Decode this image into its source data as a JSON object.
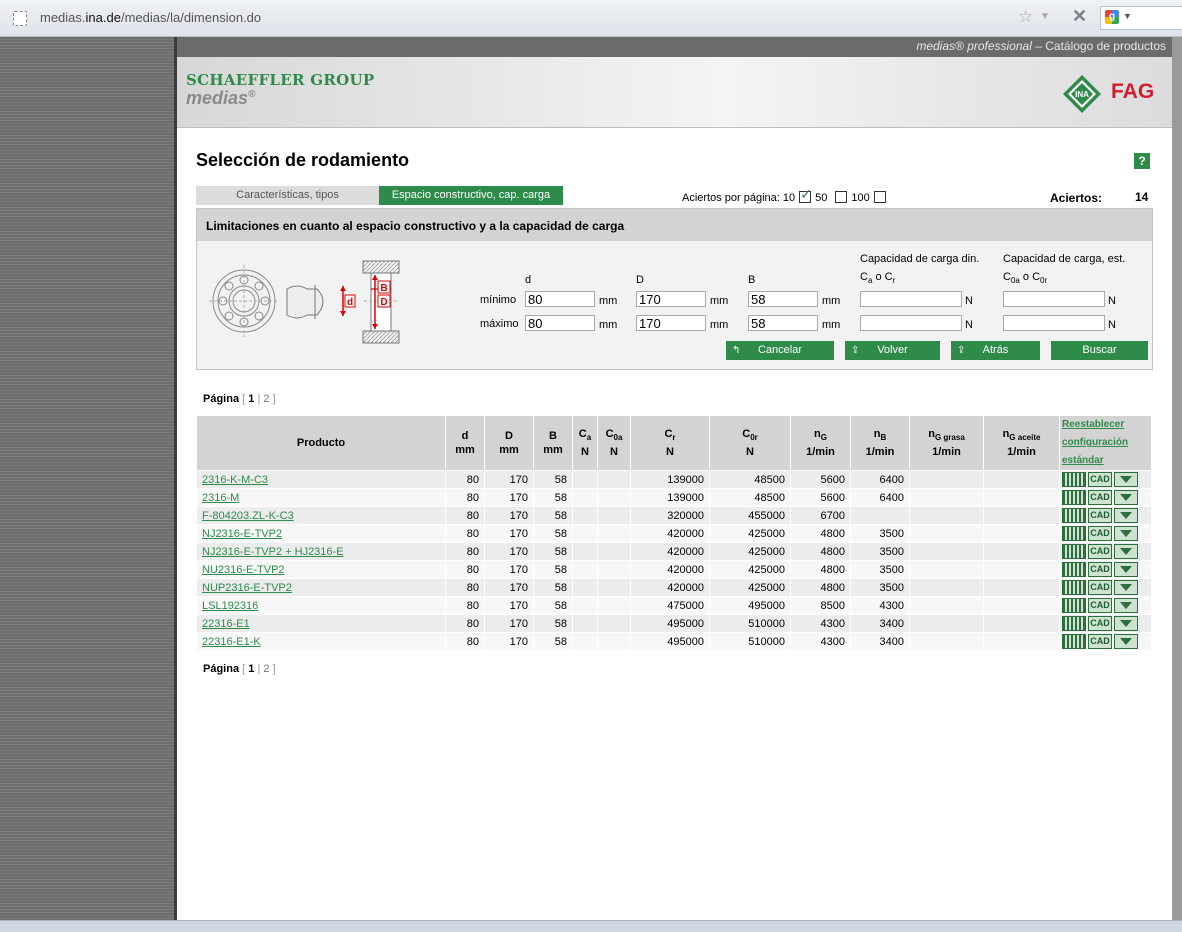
{
  "browser": {
    "url_pre": "medias.",
    "url_host": "ina.de",
    "url_post": "/medias/la/dimension.do"
  },
  "top_strip": {
    "brand_italic": "medias® professional",
    "rest": " – Catálogo de productos"
  },
  "header": {
    "group": "SCHAEFFLER GROUP",
    "medias": "medias",
    "reg": "®",
    "ina": "INA",
    "fag": "FAG"
  },
  "page": {
    "title": "Selección de rodamiento",
    "help": "?"
  },
  "tabs": [
    {
      "label": "Características, tipos"
    },
    {
      "label": "Espacio constructivo, cap. carga"
    }
  ],
  "per_page": {
    "label": "Aciertos por página: 10",
    "opt50": "50",
    "opt100": "100",
    "selected": "50"
  },
  "hits": {
    "label": "Aciertos:",
    "count": "14"
  },
  "panel": {
    "heading": "Limitaciones en cuanto al espacio constructivo y a la capacidad de carga",
    "drawing_labels": {
      "d": "d",
      "D": "D",
      "B": "B"
    },
    "col_d": "d",
    "col_D": "D",
    "col_B": "B",
    "dyn_title": "Capacidad de carga din.",
    "dyn_sub": "Ca o Cr",
    "stat_title": "Capacidad de carga, est.",
    "stat_sub": "C0a o C0r",
    "row_min": "mínimo",
    "row_max": "máximo",
    "unit_mm": "mm",
    "unit_N": "N",
    "min": {
      "d": "80",
      "D": "170",
      "B": "58",
      "dyn": "",
      "stat": ""
    },
    "max": {
      "d": "80",
      "D": "170",
      "B": "58",
      "dyn": "",
      "stat": ""
    },
    "buttons": {
      "cancel": "Cancelar",
      "back": "Volver",
      "prev": "Atrás",
      "search": "Buscar"
    }
  },
  "pagination": {
    "label": "Página",
    "open": "[",
    "p1": "1",
    "sep": "|",
    "p2": "2",
    "close": "]"
  },
  "table": {
    "headers": {
      "product": "Producto",
      "reset1": "Reestablecer",
      "reset2": "configuración",
      "reset3": "estándar"
    },
    "actions": {
      "cad": "CAD"
    },
    "rows": [
      {
        "product": "2316-K-M-C3",
        "d": "80",
        "D": "170",
        "B": "58",
        "Ca": "",
        "C0a": "",
        "Cr": "139000",
        "C0r": "48500",
        "nG": "5600",
        "nB": "6400",
        "nGg": "",
        "nGa": ""
      },
      {
        "product": "2316-M",
        "d": "80",
        "D": "170",
        "B": "58",
        "Ca": "",
        "C0a": "",
        "Cr": "139000",
        "C0r": "48500",
        "nG": "5600",
        "nB": "6400",
        "nGg": "",
        "nGa": ""
      },
      {
        "product": "F-804203.ZL-K-C3",
        "d": "80",
        "D": "170",
        "B": "58",
        "Ca": "",
        "C0a": "",
        "Cr": "320000",
        "C0r": "455000",
        "nG": "6700",
        "nB": "",
        "nGg": "",
        "nGa": ""
      },
      {
        "product": "NJ2316-E-TVP2",
        "d": "80",
        "D": "170",
        "B": "58",
        "Ca": "",
        "C0a": "",
        "Cr": "420000",
        "C0r": "425000",
        "nG": "4800",
        "nB": "3500",
        "nGg": "",
        "nGa": ""
      },
      {
        "product": "NJ2316-E-TVP2 + HJ2316-E",
        "d": "80",
        "D": "170",
        "B": "58",
        "Ca": "",
        "C0a": "",
        "Cr": "420000",
        "C0r": "425000",
        "nG": "4800",
        "nB": "3500",
        "nGg": "",
        "nGa": ""
      },
      {
        "product": "NU2316-E-TVP2",
        "d": "80",
        "D": "170",
        "B": "58",
        "Ca": "",
        "C0a": "",
        "Cr": "420000",
        "C0r": "425000",
        "nG": "4800",
        "nB": "3500",
        "nGg": "",
        "nGa": ""
      },
      {
        "product": "NUP2316-E-TVP2",
        "d": "80",
        "D": "170",
        "B": "58",
        "Ca": "",
        "C0a": "",
        "Cr": "420000",
        "C0r": "425000",
        "nG": "4800",
        "nB": "3500",
        "nGg": "",
        "nGa": ""
      },
      {
        "product": "LSL192316",
        "d": "80",
        "D": "170",
        "B": "58",
        "Ca": "",
        "C0a": "",
        "Cr": "475000",
        "C0r": "495000",
        "nG": "8500",
        "nB": "4300",
        "nGg": "",
        "nGa": ""
      },
      {
        "product": "22316-E1",
        "d": "80",
        "D": "170",
        "B": "58",
        "Ca": "",
        "C0a": "",
        "Cr": "495000",
        "C0r": "510000",
        "nG": "4300",
        "nB": "3400",
        "nGg": "",
        "nGa": ""
      },
      {
        "product": "22316-E1-K",
        "d": "80",
        "D": "170",
        "B": "58",
        "Ca": "",
        "C0a": "",
        "Cr": "495000",
        "C0r": "510000",
        "nG": "4300",
        "nB": "3400",
        "nGg": "",
        "nGa": ""
      }
    ]
  },
  "colors": {
    "accent": "#2e8b4a",
    "fag_red": "#cf1f2e"
  }
}
